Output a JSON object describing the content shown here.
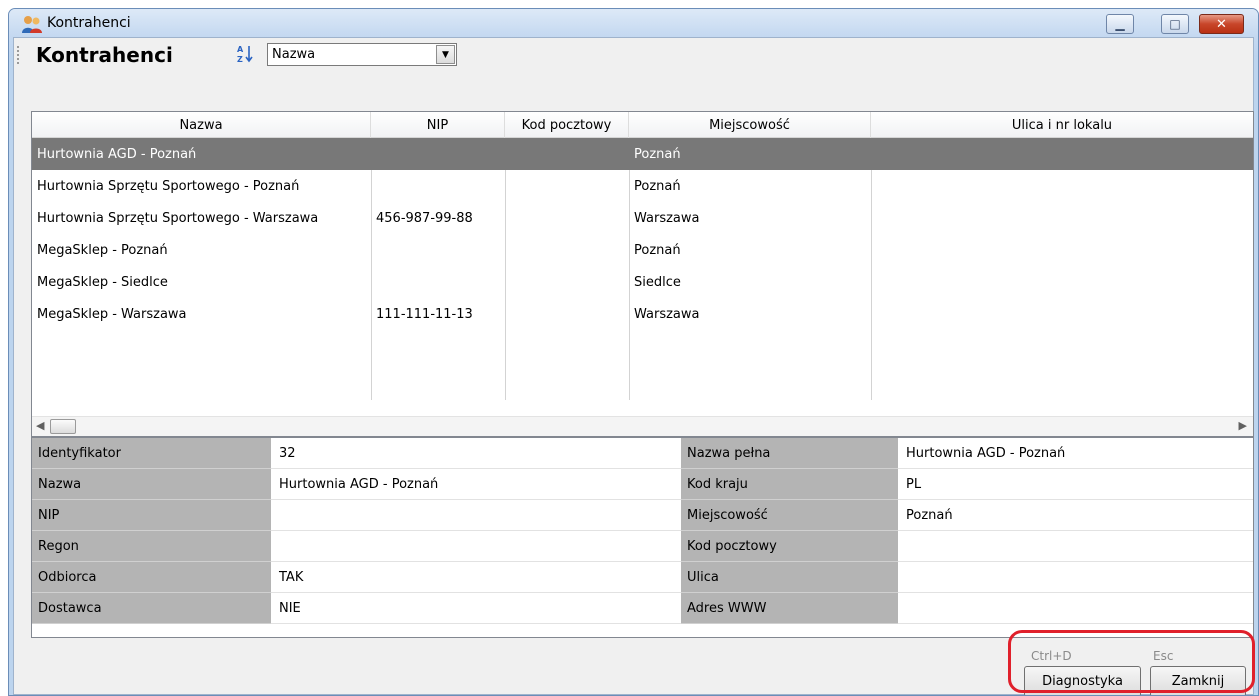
{
  "window": {
    "title": "Kontrahenci",
    "controls": {
      "minimize": "▁",
      "maximize": "□",
      "close": "✕"
    }
  },
  "toolbar": {
    "title": "Kontrahenci",
    "sort_icon": "A↓Z",
    "sort_field": "Nazwa",
    "combo_arrow": "▼"
  },
  "grid": {
    "columns": [
      "Nazwa",
      "NIP",
      "Kod pocztowy",
      "Miejscowość",
      "Ulica i nr lokalu"
    ],
    "rows": [
      {
        "nazwa": "Hurtownia AGD - Poznań",
        "nip": "",
        "kod": "",
        "miejscowosc": "Poznań",
        "ulica": ""
      },
      {
        "nazwa": "Hurtownia Sprzętu Sportowego - Poznań",
        "nip": "",
        "kod": "",
        "miejscowosc": "Poznań",
        "ulica": ""
      },
      {
        "nazwa": "Hurtownia Sprzętu Sportowego - Warszawa",
        "nip": "456-987-99-88",
        "kod": "",
        "miejscowosc": "Warszawa",
        "ulica": ""
      },
      {
        "nazwa": "MegaSklep - Poznań",
        "nip": "",
        "kod": "",
        "miejscowosc": "Poznań",
        "ulica": ""
      },
      {
        "nazwa": "MegaSklep - Siedlce",
        "nip": "",
        "kod": "",
        "miejscowosc": "Siedlce",
        "ulica": ""
      },
      {
        "nazwa": "MegaSklep - Warszawa",
        "nip": "111-111-11-13",
        "kod": "",
        "miejscowosc": "Warszawa",
        "ulica": ""
      }
    ],
    "scroll_left": "◀",
    "scroll_right": "▶"
  },
  "details": {
    "left": [
      {
        "label": "Identyfikator",
        "value": "32"
      },
      {
        "label": "Nazwa",
        "value": "Hurtownia AGD - Poznań"
      },
      {
        "label": "NIP",
        "value": ""
      },
      {
        "label": "Regon",
        "value": ""
      },
      {
        "label": "Odbiorca",
        "value": "TAK"
      },
      {
        "label": "Dostawca",
        "value": "NIE"
      }
    ],
    "right": [
      {
        "label": "Nazwa pełna",
        "value": "Hurtownia AGD - Poznań"
      },
      {
        "label": "Kod kraju",
        "value": "PL"
      },
      {
        "label": "Miejscowość",
        "value": "Poznań"
      },
      {
        "label": "Kod pocztowy",
        "value": ""
      },
      {
        "label": "Ulica",
        "value": ""
      },
      {
        "label": "Adres WWW",
        "value": ""
      }
    ]
  },
  "buttons": {
    "diagnostyka": {
      "label": "Diagnostyka",
      "shortcut": "Ctrl+D"
    },
    "zamknij": {
      "label": "Zamknij",
      "shortcut": "Esc"
    }
  },
  "annotation_color": "#e0202b"
}
